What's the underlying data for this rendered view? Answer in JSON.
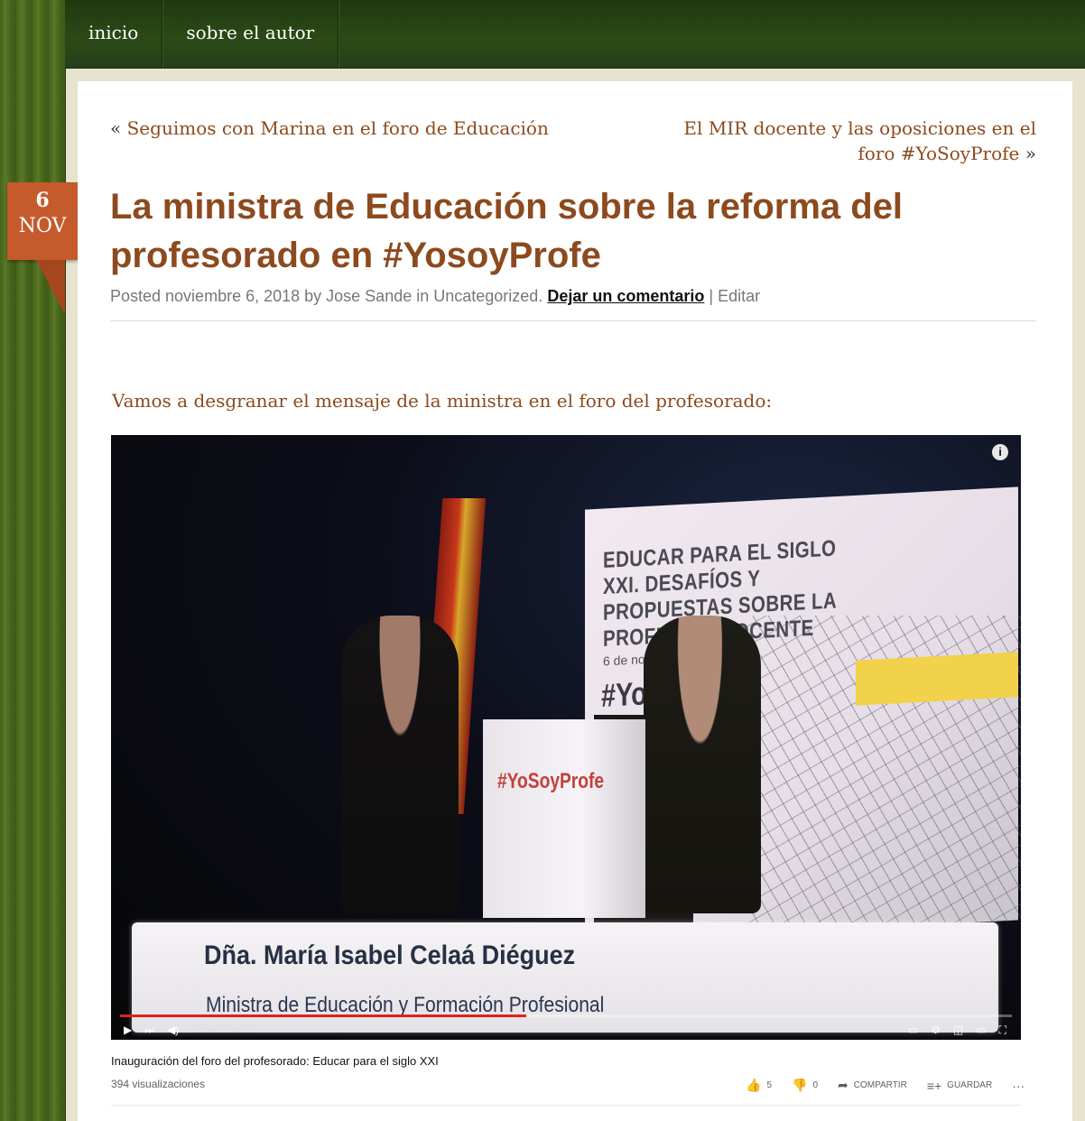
{
  "nav": {
    "items": [
      {
        "label": "inicio"
      },
      {
        "label": "sobre el autor"
      }
    ]
  },
  "post_nav": {
    "prev_arrow": "«",
    "prev_label": "Seguimos con Marina en el foro de Educación",
    "next_label": "El MIR docente y las oposiciones en el foro #YoSoyProfe",
    "next_arrow": "»"
  },
  "date_badge": {
    "day": "6",
    "month": "NOV"
  },
  "post": {
    "title": "La ministra de Educación sobre la reforma del profesorado en #YosoyProfe",
    "meta_prefix": "Posted noviembre 6, 2018 by Jose Sande in Uncategorized.",
    "comment_link": "Dejar un comentario",
    "separator": "|",
    "edit_link": "Editar",
    "intro": "Vamos a desgranar el mensaje de la ministra en el foro del profesorado:"
  },
  "video": {
    "banner_text": "EDUCAR PARA EL SIGLO XXI. DESAFÍOS Y PROPUESTAS SOBRE LA PROFESIÓN DOCENTE",
    "banner_date": "6 de noviembre",
    "banner_hashtag": "#YoSo",
    "podium_label": "#YoSoyProfe",
    "lower_third_name": "Dña. María Isabel Celaá Diéguez",
    "lower_third_role": "Ministra de Educación y Formación Profesional",
    "info_icon": "i",
    "progress_fraction": 0.455,
    "time": "1:13:49 / 2:40:05",
    "title": "Inauguración del foro del profesorado: Educar para el siglo XXI",
    "views": "394 visualizaciones",
    "likes": "5",
    "dislikes": "0",
    "share_label": "COMPARTIR",
    "save_label": "GUARDAR",
    "more_label": "···"
  },
  "colors": {
    "link": "#8c4a1e",
    "badge": "#c55a2d",
    "navbar": "#2c4a17",
    "progress": "#e0231c"
  }
}
